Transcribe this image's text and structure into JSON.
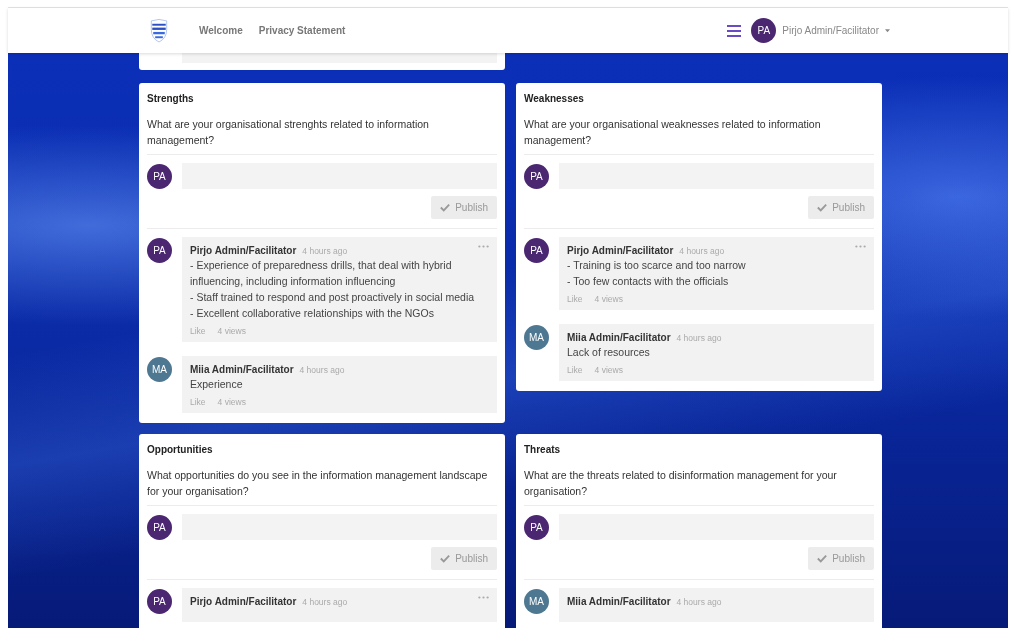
{
  "header": {
    "nav": [
      {
        "label": "Welcome"
      },
      {
        "label": "Privacy Statement"
      }
    ],
    "user": {
      "initials": "PA",
      "color": "#4b2772",
      "name": "Pirjo Admin/Facilitator"
    }
  },
  "cards": [
    {
      "title": "Strengths",
      "question": "What are your organisational strenghts related to information management?",
      "composer": {
        "initials": "PA",
        "color": "#4b2772",
        "button": "Publish"
      },
      "comments": [
        {
          "initials": "PA",
          "color": "#4b2772",
          "author": "Pirjo Admin/Facilitator",
          "time": "4 hours ago",
          "menu": true,
          "lines": [
            "- Experience of preparedness drills, that deal with hybrid influencing, including information influencing",
            "- Staff trained to respond and post proactively in social media",
            "- Excellent collaborative relationships with the NGOs"
          ],
          "like": "Like",
          "views": "4 views"
        },
        {
          "initials": "MA",
          "color": "#4e7892",
          "author": "Miia Admin/Facilitator",
          "time": "4 hours ago",
          "menu": false,
          "lines": [
            "Experience"
          ],
          "like": "Like",
          "views": "4 views"
        }
      ]
    },
    {
      "title": "Weaknesses",
      "question": "What are your organisational weaknesses related to information management?",
      "composer": {
        "initials": "PA",
        "color": "#4b2772",
        "button": "Publish"
      },
      "comments": [
        {
          "initials": "PA",
          "color": "#4b2772",
          "author": "Pirjo Admin/Facilitator",
          "time": "4 hours ago",
          "menu": true,
          "lines": [
            "- Training is too scarce and too narrow",
            "- Too few contacts with the officials"
          ],
          "like": "Like",
          "views": "4 views"
        },
        {
          "initials": "MA",
          "color": "#4e7892",
          "author": "Miia Admin/Facilitator",
          "time": "4 hours ago",
          "menu": false,
          "lines": [
            "Lack of resources"
          ],
          "like": "Like",
          "views": "4 views"
        }
      ]
    },
    {
      "title": "Opportunities",
      "question": "What opportunities do you see in the information management landscape for your organisation?",
      "composer": {
        "initials": "PA",
        "color": "#4b2772",
        "button": "Publish"
      },
      "comments": [
        {
          "initials": "PA",
          "color": "#4b2772",
          "author": "Pirjo Admin/Facilitator",
          "time": "4 hours ago",
          "menu": true
        }
      ]
    },
    {
      "title": "Threats",
      "question": "What are the threats related to disinformation management for your organisation?",
      "composer": {
        "initials": "PA",
        "color": "#4b2772",
        "button": "Publish"
      },
      "comments": [
        {
          "initials": "MA",
          "color": "#4e7892",
          "author": "Miia Admin/Facilitator",
          "time": "4 hours ago",
          "menu": false
        }
      ]
    }
  ]
}
